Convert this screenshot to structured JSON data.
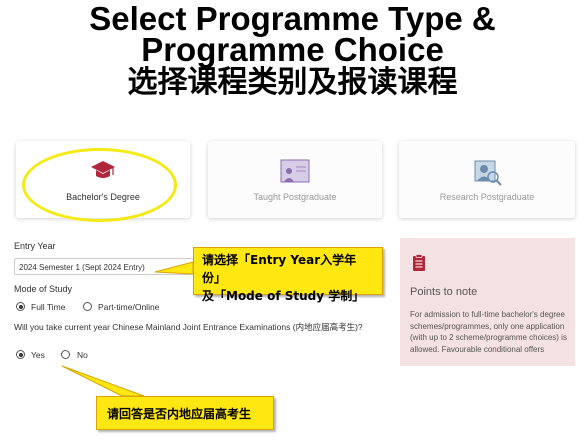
{
  "header": {
    "line1": "Select Programme Type &",
    "line2": "Programme Choice",
    "line3": "选择课程类别及报读课程"
  },
  "programme_types": [
    {
      "label": "Bachelor's Degree",
      "icon": "graduation-cap-icon",
      "selected": true
    },
    {
      "label": "Taught Postgraduate",
      "icon": "presentation-board-icon",
      "selected": false
    },
    {
      "label": "Research Postgraduate",
      "icon": "research-person-icon",
      "selected": false
    }
  ],
  "form": {
    "entry_year_label": "Entry Year",
    "entry_year_value": "2024 Semester 1 (Sept 2024 Entry)",
    "mode_label": "Mode of Study",
    "mode_options": [
      {
        "label": "Full Time",
        "checked": true
      },
      {
        "label": "Part-time/Online",
        "checked": false
      }
    ],
    "gaokao_question": "Will you take current year Chinese Mainland Joint Entrance Examinations (内地应届高考生)?",
    "gaokao_options": [
      {
        "label": "Yes",
        "checked": true
      },
      {
        "label": "No",
        "checked": false
      }
    ]
  },
  "callouts": {
    "entry_line1": "请选择「Entry Year入学年份」",
    "entry_line2": "及「Mode of Study 学制」",
    "gaokao": "请回答是否内地应届高考生"
  },
  "notes": {
    "icon": "clipboard-icon",
    "title": "Points to note",
    "body": "For admission to full-time bachelor's degree schemes/programmes, only one application (with up to 2 scheme/programme choices) is allowed. Favourable conditional offers"
  },
  "colors": {
    "highlight": "#f5ea14",
    "callout_bg": "#ffe711",
    "accent_red": "#b0263a",
    "notes_bg": "#f4e1e1"
  }
}
